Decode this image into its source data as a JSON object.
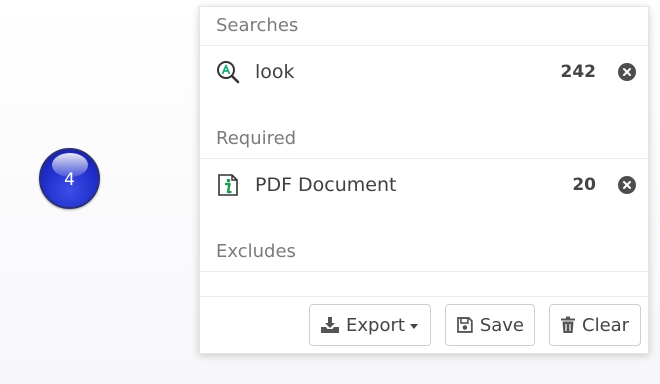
{
  "step_badge": {
    "number": "4"
  },
  "panel": {
    "sections": {
      "searches": {
        "title": "Searches",
        "items": [
          {
            "icon": "search-icon",
            "label": "look",
            "count": "242"
          }
        ]
      },
      "required": {
        "title": "Required",
        "items": [
          {
            "icon": "document-info-icon",
            "label": "PDF Document",
            "count": "20"
          }
        ]
      },
      "excludes": {
        "title": "Excludes",
        "items": []
      }
    },
    "footer": {
      "export_label": "Export",
      "save_label": "Save",
      "clear_label": "Clear"
    }
  },
  "colors": {
    "badge": "#1e2bc6",
    "search_icon_accent": "#1fae7c"
  }
}
